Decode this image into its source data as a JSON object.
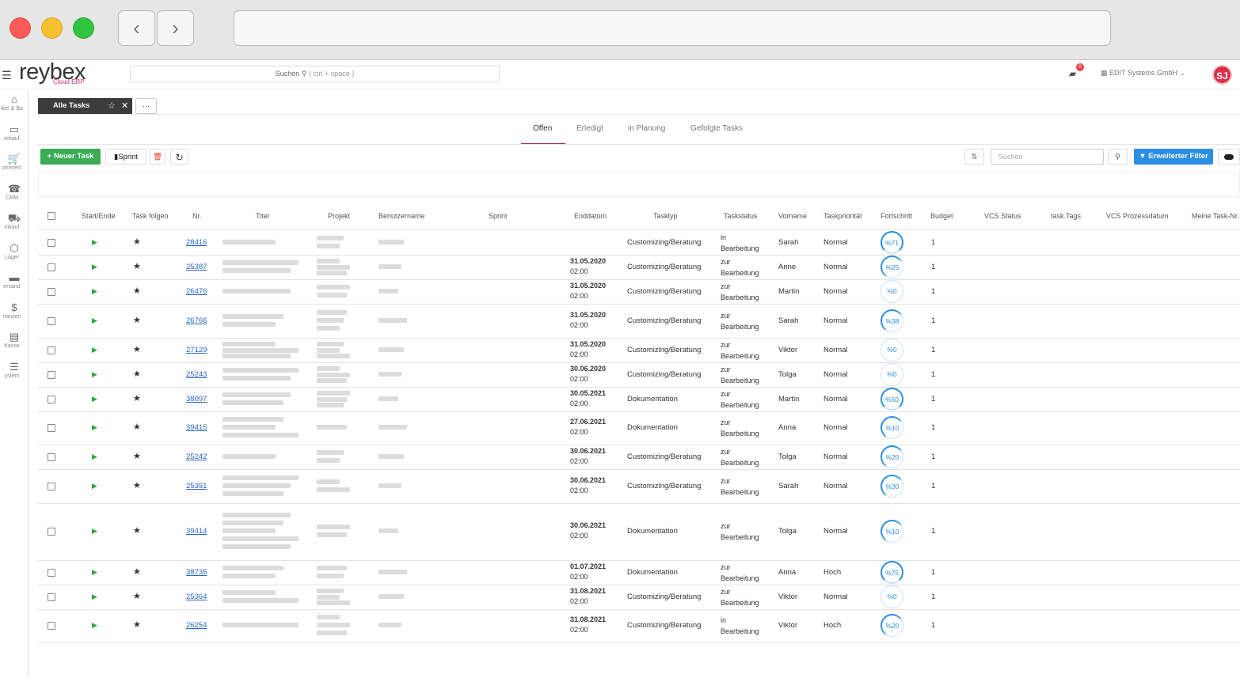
{
  "browser": {
    "back_icon": "‹",
    "forward_icon": "›"
  },
  "app": {
    "logo": "reybex",
    "logo_sub": "Cloud ERP",
    "search_label": "Suchen",
    "search_hint": "( ctrl + space )",
    "notification_count": "0",
    "company": "EDIT Systems GmbH",
    "avatar": "SJ"
  },
  "sidebar": [
    {
      "icon": "⌂",
      "label": "ikel & Ba"
    },
    {
      "icon": "▭",
      "label": "erkauf"
    },
    {
      "icon": "🛒",
      "label": "ommerc"
    },
    {
      "icon": "☎",
      "label": "CRM"
    },
    {
      "icon": "⛟",
      "label": "inkauf"
    },
    {
      "icon": "⬡",
      "label": "Lager"
    },
    {
      "icon": "▬",
      "label": "ersand"
    },
    {
      "icon": "$",
      "label": "nanzen"
    },
    {
      "icon": "▤",
      "label": "Kasse"
    },
    {
      "icon": "☰",
      "label": "ystem"
    }
  ],
  "tabs": {
    "active": "Alle Tasks",
    "more": "···"
  },
  "subtabs": [
    "Offen",
    "Erledigt",
    "in Planung",
    "Gefolgte Tasks"
  ],
  "toolbar": {
    "new_task": "+ Neuer Task",
    "sprint": "Sprint",
    "delete_icon": "🗑",
    "refresh_icon": "↻",
    "sort_icon": "⇅",
    "search_placeholder": "Suchen",
    "search_icon": "⚲",
    "advanced_filter": "Erweiterter Filter"
  },
  "columns": [
    "Start/Ende",
    "Task folgen",
    "Nr.",
    "Titel",
    "Projekt",
    "Benutzername",
    "Sprint",
    "Enddatum",
    "Tasktyp",
    "Taskstatus",
    "Vorname",
    "Taskpriorität",
    "Fortschritt",
    "Budget",
    "VCS Status",
    "task.Tags",
    "VCS Prozessdatum",
    "Meine Task-Nr."
  ],
  "rows": [
    {
      "nr": "28416",
      "date": "",
      "time": "",
      "type": "Customizing/Beratung",
      "status1": "in",
      "status2": "Bearbeitung",
      "first": "Sarah",
      "prio": "Normal",
      "prog": "%71",
      "budget": "1"
    },
    {
      "nr": "25387",
      "date": "31.05.2020",
      "time": "02:00",
      "type": "Customizing/Beratung",
      "status1": "zur",
      "status2": "Bearbeitung",
      "first": "Anne",
      "prio": "Normal",
      "prog": "%25",
      "budget": "1"
    },
    {
      "nr": "26476",
      "date": "31.05.2020",
      "time": "02:00",
      "type": "Customizing/Beratung",
      "status1": "zur",
      "status2": "Bearbeitung",
      "first": "Martin",
      "prio": "Normal",
      "prog": "%0",
      "budget": "1"
    },
    {
      "nr": "26766",
      "date": "31.05.2020",
      "time": "02:00",
      "type": "Customizing/Beratung",
      "status1": "zur",
      "status2": "Bearbeitung",
      "first": "Sarah",
      "prio": "Normal",
      "prog": "%38",
      "budget": "1"
    },
    {
      "nr": "27129",
      "date": "31.05.2020",
      "time": "02:00",
      "type": "Customizing/Beratung",
      "status1": "zur",
      "status2": "Bearbeitung",
      "first": "Viktor",
      "prio": "Normal",
      "prog": "%0",
      "budget": "1"
    },
    {
      "nr": "25243",
      "date": "30.06.2020",
      "time": "02:00",
      "type": "Customizing/Beratung",
      "status1": "zur",
      "status2": "Bearbeitung",
      "first": "Tolga",
      "prio": "Normal",
      "prog": "%0",
      "budget": "1"
    },
    {
      "nr": "38097",
      "date": "30.05.2021",
      "time": "02:00",
      "type": "Dokumentation",
      "status1": "zur",
      "status2": "Bearbeitung",
      "first": "Martin",
      "prio": "Normal",
      "prog": "%50",
      "budget": "1"
    },
    {
      "nr": "39415",
      "date": "27.06.2021",
      "time": "02:00",
      "type": "Dokumentation",
      "status1": "zur",
      "status2": "Bearbeitung",
      "first": "Anna",
      "prio": "Normal",
      "prog": "%10",
      "budget": "1"
    },
    {
      "nr": "25242",
      "date": "30.06.2021",
      "time": "02:00",
      "type": "Customizing/Beratung",
      "status1": "zur",
      "status2": "Bearbeitung",
      "first": "Tolga",
      "prio": "Normal",
      "prog": "%20",
      "budget": "1"
    },
    {
      "nr": "25351",
      "date": "30.06.2021",
      "time": "02:00",
      "type": "Customizing/Beratung",
      "status1": "zur",
      "status2": "Bearbeitung",
      "first": "Sarah",
      "prio": "Normal",
      "prog": "%30",
      "budget": "1"
    },
    {
      "nr": "39414",
      "date": "30.06.2021",
      "time": "02:00",
      "type": "Dokumentation",
      "status1": "zur",
      "status2": "Bearbeitung",
      "first": "Tolga",
      "prio": "Normal",
      "prog": "%10",
      "budget": "1"
    },
    {
      "nr": "38735",
      "date": "01.07.2021",
      "time": "02:00",
      "type": "Dokumentation",
      "status1": "zur",
      "status2": "Bearbeitung",
      "first": "Anna",
      "prio": "Hoch",
      "prog": "%75",
      "budget": "1"
    },
    {
      "nr": "25364",
      "date": "31.08.2021",
      "time": "02:00",
      "type": "Customizing/Beratung",
      "status1": "zur",
      "status2": "Bearbeitung",
      "first": "Viktor",
      "prio": "Normal",
      "prog": "%0",
      "budget": "1"
    },
    {
      "nr": "26254",
      "date": "31.08.2021",
      "time": "02:00",
      "type": "Customizing/Beratung",
      "status1": "in",
      "status2": "Bearbeitung",
      "first": "Viktor",
      "prio": "Hoch",
      "prog": "%20",
      "budget": "1"
    }
  ]
}
